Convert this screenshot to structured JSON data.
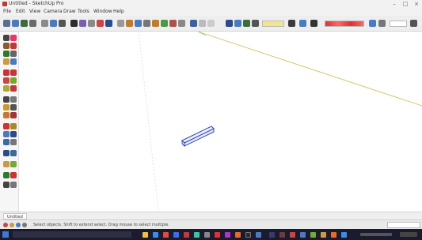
{
  "window": {
    "title": "Untitled - SketchUp Pro",
    "minimize": "–",
    "maximize": "□",
    "close": "×"
  },
  "menu": [
    "File",
    "Edit",
    "View",
    "Camera",
    "Draw",
    "Tools",
    "Window",
    "Help"
  ],
  "toolbar_icons": [
    "select-icon",
    "new-file-icon",
    "open-icon",
    "save-icon",
    "cut-icon",
    "copy-icon",
    "paste-icon",
    "erase-icon",
    "undo-icon",
    "redo-icon",
    "print-icon",
    "model-info-icon",
    "camera-icon",
    "orbit-icon",
    "pan-icon",
    "zoom-icon",
    "zoom-extents-icon",
    "previous-view-icon",
    "iso-view-icon",
    "top-view-icon",
    "front-view-icon",
    "right-view-icon",
    "xray-icon",
    "wireframe-icon",
    "shaded-icon",
    "textured-icon",
    "layer-icon",
    "warehouse-icon",
    "extension-icon"
  ],
  "left_tools": [
    "select-tool-icon",
    "eraser-tool-icon",
    "paint-bucket-icon",
    "line-tool-icon",
    "rectangle-tool-icon",
    "circle-tool-icon",
    "arc-tool-icon",
    "polygon-tool-icon",
    "push-pull-icon",
    "move-tool-icon",
    "rotate-tool-icon",
    "scale-tool-icon",
    "follow-me-icon",
    "offset-tool-icon",
    "tape-measure-icon",
    "dimension-tool-icon",
    "protractor-icon",
    "text-tool-icon",
    "axes-tool-icon",
    "3d-text-icon",
    "orbit-tool-icon",
    "pan-tool-icon",
    "zoom-tool-icon",
    "zoom-window-icon",
    "zoom-extents-tool-icon",
    "walk-icon",
    "look-around-icon",
    "position-camera-icon",
    "section-plane-icon",
    "sandbox-icon"
  ],
  "scene_tab": "Untitled",
  "status": {
    "text": "Select objects. Shift to extend select. Drag mouse to select multiple.",
    "measurements_label": ""
  },
  "colors": {
    "axis_green": "#7bd37b",
    "axis_red": "#d97b7b",
    "axis_yellow": "#d2c26b",
    "object_outline": "#3a4fb4"
  },
  "taskbar_icons": [
    "file-explorer-icon",
    "edge-icon",
    "chrome-icon",
    "mail-icon",
    "store-icon",
    "photos-icon",
    "settings-icon",
    "sketchup-icon",
    "media-icon",
    "office-icon",
    "terminal-icon",
    "calculator-icon"
  ]
}
